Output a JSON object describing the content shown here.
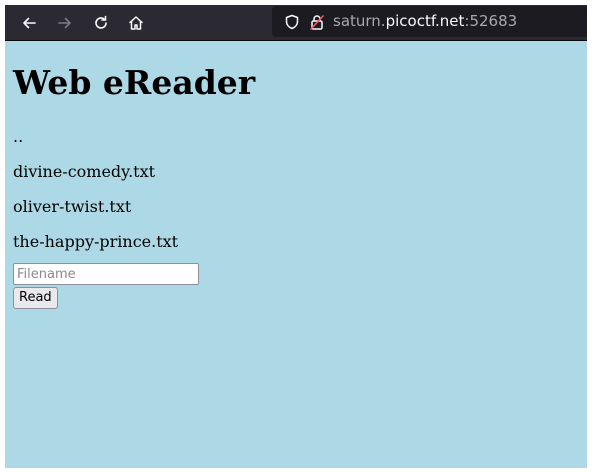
{
  "browser": {
    "url_prefix": "saturn.",
    "url_domain": "picoctf.net",
    "url_suffix": ":52683",
    "icons": [
      "back-arrow-icon",
      "forward-arrow-icon",
      "reload-icon",
      "home-icon",
      "shield-icon",
      "lock-icon"
    ],
    "toolbar_color": "#2b2a33",
    "urlbar_color": "#1c1b22"
  },
  "page": {
    "title": "Web eReader",
    "background": "#add8e6",
    "links": [
      "..",
      "divine-comedy.txt",
      "oliver-twist.txt",
      "the-happy-prince.txt"
    ],
    "form": {
      "filename_placeholder": "Filename",
      "filename_value": "",
      "read_button_label": "Read"
    }
  }
}
